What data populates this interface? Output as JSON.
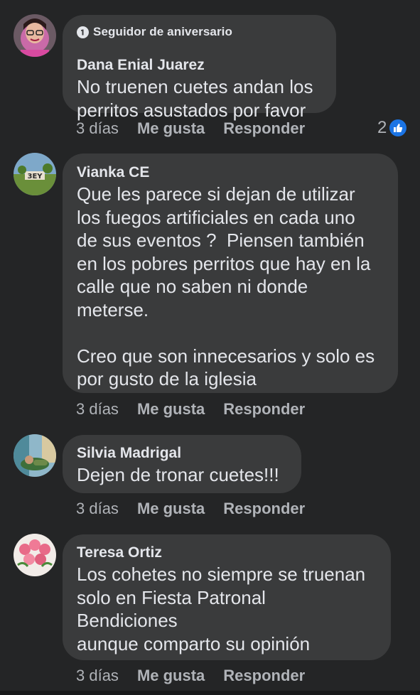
{
  "comments": [
    {
      "badge": "Seguidor de aniversario",
      "author": "Dana Enial Juarez",
      "text": "No truenen cuetes andan los\nperritos asustados por favor",
      "time": "3 días",
      "like_label": "Me gusta",
      "reply_label": "Responder",
      "reaction_count": "2"
    },
    {
      "author": "Vianka CE",
      "text": "Que les parece si dejan de utilizar\nlos fuegos artificiales en cada uno\nde sus eventos ?  Piensen también\nen los pobres perritos que hay en la\ncalle que no saben ni donde\nmeterse.\n\nCreo que son innecesarios y solo es\npor gusto de la iglesia",
      "time": "3 días",
      "like_label": "Me gusta",
      "reply_label": "Responder"
    },
    {
      "author": "Silvia Madrigal",
      "text": "Dejen de tronar cuetes!!!",
      "time": "3 días",
      "like_label": "Me gusta",
      "reply_label": "Responder"
    },
    {
      "author": "Teresa Ortiz",
      "text": "Los cohetes no siempre se truenan\nsolo en Fiesta Patronal\nBendiciones\naunque comparto su opinión",
      "time": "3 días",
      "like_label": "Me gusta",
      "reply_label": "Responder"
    }
  ],
  "colors": {
    "background": "#242526",
    "bubble": "#3a3b3c",
    "text_primary": "#e4e6eb",
    "text_secondary": "#b0b3b8",
    "like_blue": "#1b74e4"
  },
  "icons": {
    "badge": "anniversary-badge-icon",
    "reaction": "thumbs-up-icon"
  }
}
